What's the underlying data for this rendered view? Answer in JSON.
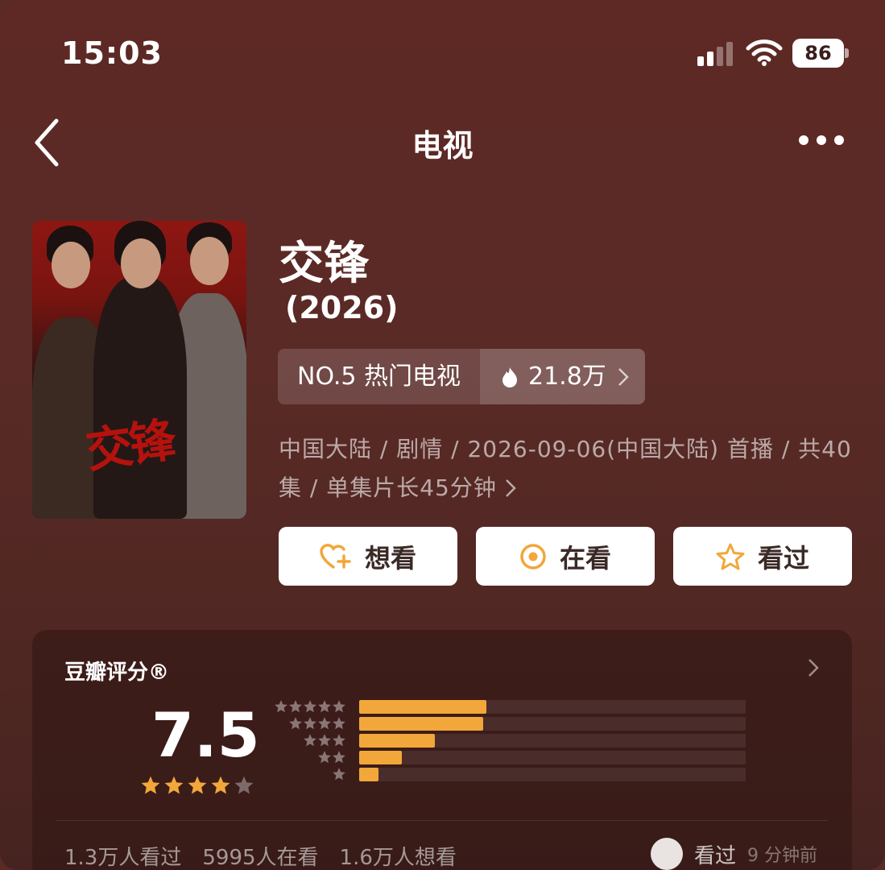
{
  "status_bar": {
    "time": "15:03",
    "battery": "86"
  },
  "nav": {
    "title": "电视"
  },
  "show": {
    "title": "交锋",
    "year": "(2026)",
    "rank_label": "NO.5 热门电视",
    "heat": "21.8万",
    "meta_line1": "中国大陆 / 剧情 / 2026-09-06(中国大陆) 首播 / 共40",
    "meta_line2": "集 / 单集片长45分钟",
    "poster_title": "交锋"
  },
  "actions": {
    "want": "想看",
    "watching": "在看",
    "watched": "看过"
  },
  "rating": {
    "title": "豆瓣评分®",
    "score": "7.5",
    "stars": 4,
    "distribution": [
      {
        "stars": 5,
        "fraction": 0.33
      },
      {
        "stars": 4,
        "fraction": 0.32
      },
      {
        "stars": 3,
        "fraction": 0.195
      },
      {
        "stars": 2,
        "fraction": 0.11
      },
      {
        "stars": 1,
        "fraction": 0.05
      }
    ],
    "stats": [
      "1.3万人看过",
      "5995人在看",
      "1.6万人想看"
    ],
    "friend_seen": {
      "label": "看过",
      "time": "9 分钟前"
    }
  },
  "colors": {
    "background": "#5a2a24",
    "accent": "#f2a73a",
    "button_bg": "#ffffff"
  },
  "icons": [
    "back-icon",
    "more-icon",
    "flame-icon",
    "chevron-right-icon",
    "heart-plus-icon",
    "target-icon",
    "star-icon"
  ]
}
